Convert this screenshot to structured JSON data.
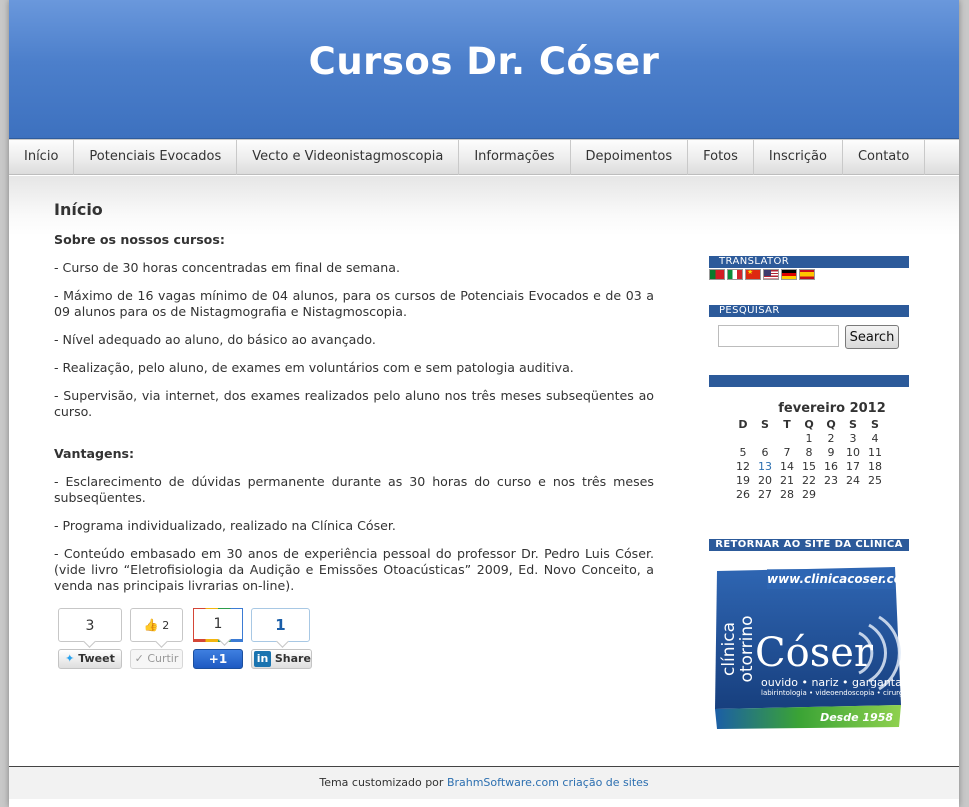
{
  "site": {
    "title": "Cursos Dr. Cóser"
  },
  "nav": {
    "items": [
      {
        "label": "Início"
      },
      {
        "label": "Potenciais Evocados"
      },
      {
        "label": "Vecto e Videonistagmoscopia"
      },
      {
        "label": "Informações"
      },
      {
        "label": "Depoimentos"
      },
      {
        "label": "Fotos"
      },
      {
        "label": "Inscrição"
      },
      {
        "label": "Contato"
      }
    ]
  },
  "main": {
    "heading": "Início",
    "section1_title": "Sobre os nossos cursos:",
    "items1": [
      "- Curso de 30 horas concentradas em final de semana.",
      "- Máximo de 16 vagas mínimo de 04 alunos, para os cursos de Potenciais Evocados e de 03 a 09 alunos para os de Nistagmografia e Nistagmoscopia.",
      "- Nível adequado ao aluno, do básico ao avançado.",
      "- Realização, pelo aluno, de exames em voluntários com e sem patologia auditiva.",
      "- Supervisão, via internet, dos exames realizados pelo aluno nos três meses subseqüentes ao curso."
    ],
    "section2_title": "Vantagens:",
    "items2": [
      "- Esclarecimento de dúvidas permanente durante as 30 horas do curso e nos três meses subseqüentes.",
      "- Programa individualizado, realizado na Clínica Cóser.",
      "- Conteúdo embasado em 30 anos de experiência pessoal do professor Dr. Pedro Luis Cóser. (vide livro “Eletrofisiologia da Audição e Emissões Otoacústicas” 2009, Ed. Novo Conceito, a venda nas principais livrarias on-line)."
    ]
  },
  "share": {
    "tweet_count": "3",
    "tweet_label": "Tweet",
    "like_count": "2",
    "like_label": "Curtir",
    "plusone_count": "1",
    "plusone_label": "+1",
    "linkedin_count": "1",
    "linkedin_label": "Share",
    "linkedin_logo": "in"
  },
  "sidebar": {
    "translator_title": "TRANSLATOR",
    "flags": [
      "portugal-flag-icon",
      "italy-flag-icon",
      "china-flag-icon",
      "usa-flag-icon",
      "germany-flag-icon",
      "spain-flag-icon"
    ],
    "search_title": "PESQUISAR",
    "search_placeholder": "",
    "search_button": "Search",
    "calendar": {
      "caption": "fevereiro 2012",
      "weekdays": [
        "D",
        "S",
        "T",
        "Q",
        "Q",
        "S",
        "S"
      ],
      "weeks": [
        [
          "",
          "",
          "",
          "1",
          "2",
          "3",
          "4"
        ],
        [
          "5",
          "6",
          "7",
          "8",
          "9",
          "10",
          "11"
        ],
        [
          "12",
          "13",
          "14",
          "15",
          "16",
          "17",
          "18"
        ],
        [
          "19",
          "20",
          "21",
          "22",
          "23",
          "24",
          "25"
        ],
        [
          "26",
          "27",
          "28",
          "29",
          "",
          "",
          ""
        ]
      ],
      "linked_day": "13"
    },
    "clinic_title": "RETORNAR AO SITE DA CLÍNICA",
    "clinic_logo": {
      "url_text": "www.clinicacoser.com",
      "vertical_text": "clínica otorrino",
      "name": "Cóser",
      "line1": "ouvido • nariz • garganta",
      "line2": "labirintologia • videoendoscopia • cirurgia",
      "since": "Desde 1958"
    }
  },
  "footer": {
    "prefix": "Tema customizado por ",
    "link": "BrahmSoftware.com criação de sites"
  },
  "colors": {
    "header_blue": "#4c7fcb",
    "widget_title_bg": "#2c5a9a",
    "link_blue": "#2c6fb0"
  }
}
